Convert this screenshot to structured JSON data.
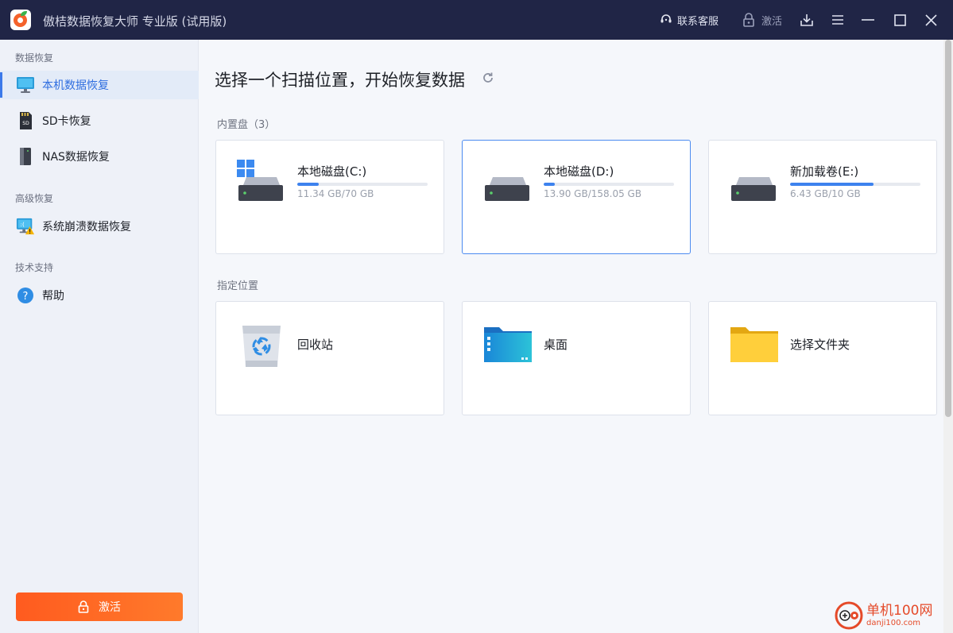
{
  "app": {
    "title": "傲桔数据恢复大师 专业版 (试用版)",
    "logo_icon": "app-logo-icon"
  },
  "titlebar": {
    "support_label": "联系客服",
    "activate_label": "激活",
    "icons": [
      "headset-icon",
      "lock-icon",
      "download-icon",
      "menu-icon",
      "minimize-icon",
      "maximize-icon",
      "close-icon"
    ]
  },
  "sidebar": {
    "sections": [
      {
        "label": "数据恢复"
      },
      {
        "label": "高级恢复"
      },
      {
        "label": "技术支持"
      }
    ],
    "items": [
      {
        "label": "本机数据恢复",
        "icon": "monitor-icon",
        "active": true
      },
      {
        "label": "SD卡恢复",
        "icon": "sd-card-icon",
        "active": false
      },
      {
        "label": "NAS数据恢复",
        "icon": "nas-icon",
        "active": false
      },
      {
        "label": "系统崩溃数据恢复",
        "icon": "system-crash-icon",
        "active": false
      },
      {
        "label": "帮助",
        "icon": "help-icon",
        "active": false
      }
    ],
    "activate_button": "激活"
  },
  "main": {
    "title": "选择一个扫描位置，开始恢复数据",
    "internal_disks_label": "内置盘（3）",
    "disks": [
      {
        "name": "本地磁盘(C:)",
        "size": "11.34 GB/70 GB",
        "used_fraction": 0.162,
        "system": true,
        "selected": false
      },
      {
        "name": "本地磁盘(D:)",
        "size": "13.90 GB/158.05 GB",
        "used_fraction": 0.088,
        "system": false,
        "selected": true
      },
      {
        "name": "新加载卷(E:)",
        "size": "6.43 GB/10 GB",
        "used_fraction": 0.643,
        "system": false,
        "selected": false
      }
    ],
    "locations_label": "指定位置",
    "locations": [
      {
        "name": "回收站",
        "icon": "recycle-bin-icon"
      },
      {
        "name": "桌面",
        "icon": "desktop-folder-icon"
      },
      {
        "name": "选择文件夹",
        "icon": "folder-icon"
      }
    ]
  },
  "watermark": {
    "title": "单机100网",
    "url": "danji100.com"
  },
  "colors": {
    "titlebar": "#202546",
    "accent": "#3d82ee",
    "activate": "#ff6a26"
  }
}
